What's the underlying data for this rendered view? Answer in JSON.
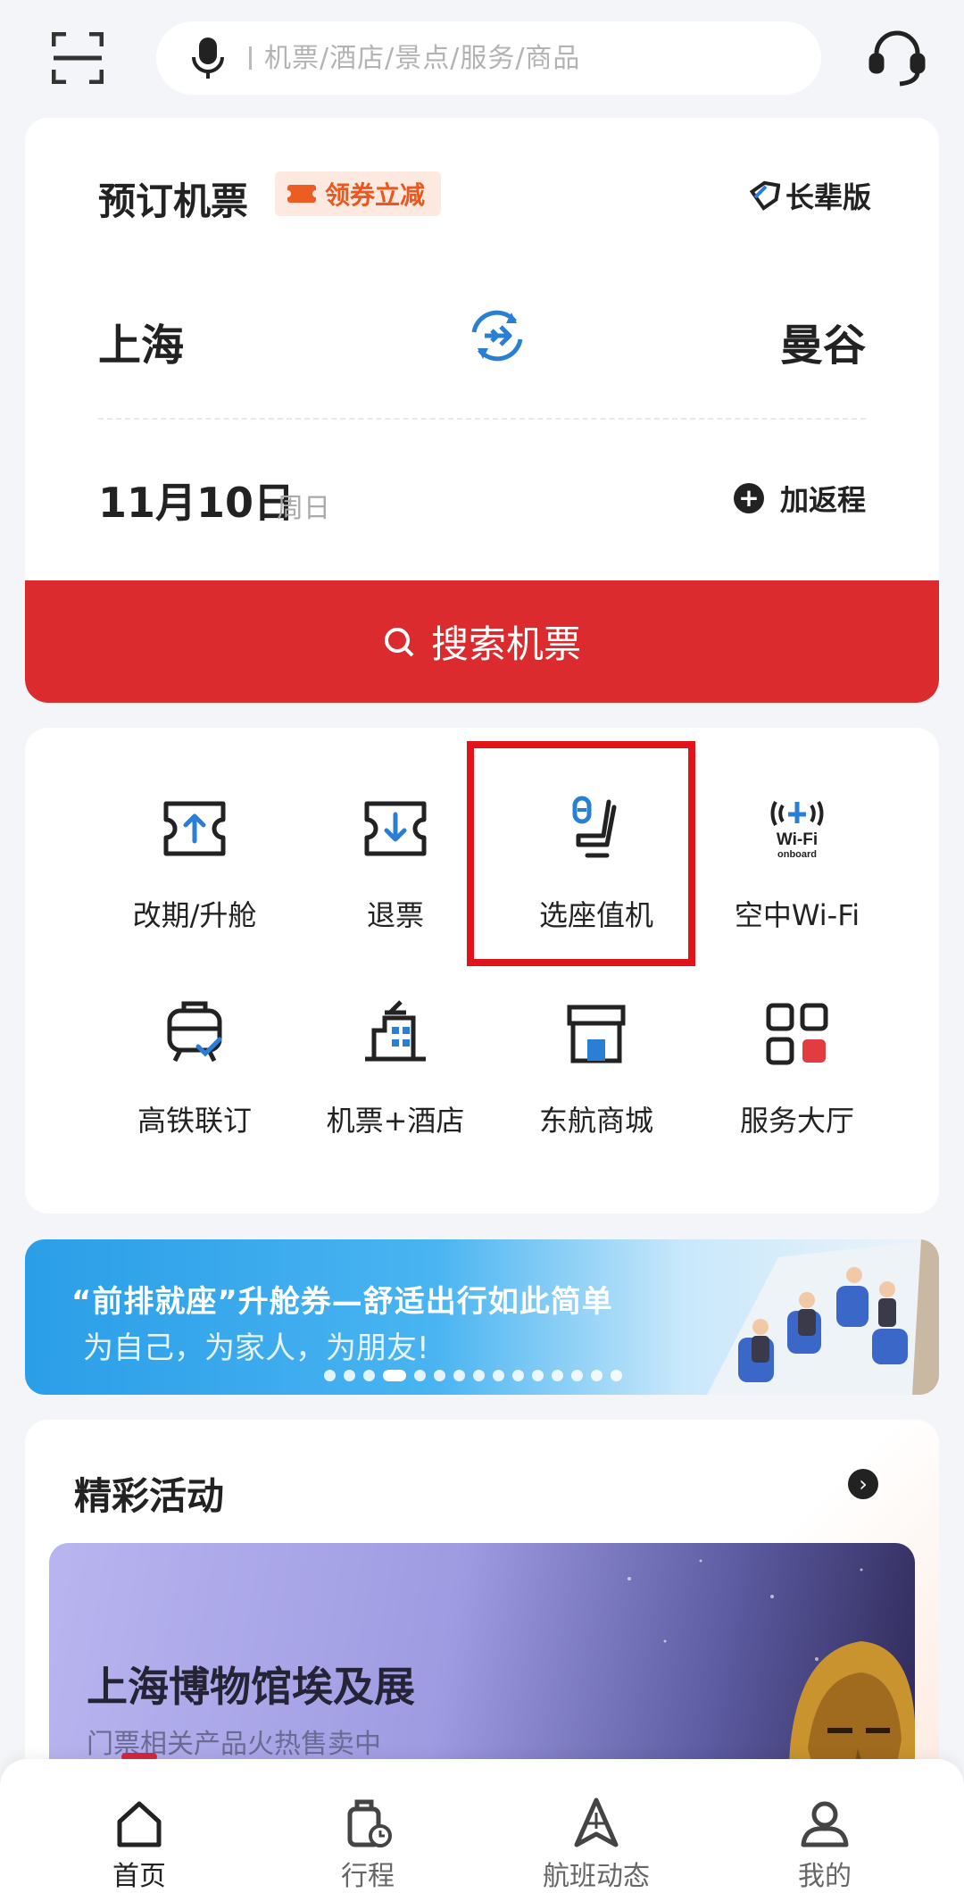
{
  "search": {
    "placeholder": "机票/酒店/景点/服务/商品"
  },
  "booking": {
    "title": "预订机票",
    "coupon": "领券立减",
    "elder_mode": "长辈版",
    "from_city": "上海",
    "to_city": "曼谷",
    "date": "11月10日",
    "weekday": "周日",
    "add_return": "加返程",
    "search_button": "搜索机票"
  },
  "services": [
    {
      "label": "改期/升舱",
      "icon": "ticket-upgrade-icon"
    },
    {
      "label": "退票",
      "icon": "ticket-refund-icon"
    },
    {
      "label": "选座值机",
      "icon": "seat-icon"
    },
    {
      "label": "空中Wi-Fi",
      "icon": "wifi-onboard-icon"
    },
    {
      "label": "高铁联订",
      "icon": "train-icon"
    },
    {
      "label": "机票+酒店",
      "icon": "hotel-icon"
    },
    {
      "label": "东航商城",
      "icon": "shop-icon"
    },
    {
      "label": "服务大厅",
      "icon": "grid-icon"
    }
  ],
  "wifi_icon_text": {
    "top": "Wi-Fi",
    "bottom": "onboard"
  },
  "banner": {
    "title": "“前排就座”升舱券—舒适出行如此简单",
    "subtitle": "为自己，为家人，为朋友!",
    "dot_count": 15,
    "active_dot": 3
  },
  "activities": {
    "title": "精彩活动",
    "promo_title": "上海博物馆埃及展",
    "promo_subtitle": "门票相关产品火热售卖中"
  },
  "nav": [
    {
      "label": "首页",
      "icon": "home-icon",
      "active": true
    },
    {
      "label": "行程",
      "icon": "luggage-icon",
      "active": false
    },
    {
      "label": "航班动态",
      "icon": "flight-status-icon",
      "active": false
    },
    {
      "label": "我的",
      "icon": "profile-icon",
      "active": false
    }
  ],
  "colors": {
    "primary_red": "#dc2b2e",
    "icon_blue": "#2a7fd4",
    "highlight_red": "#e2141b",
    "coupon_orange": "#e8581f"
  }
}
